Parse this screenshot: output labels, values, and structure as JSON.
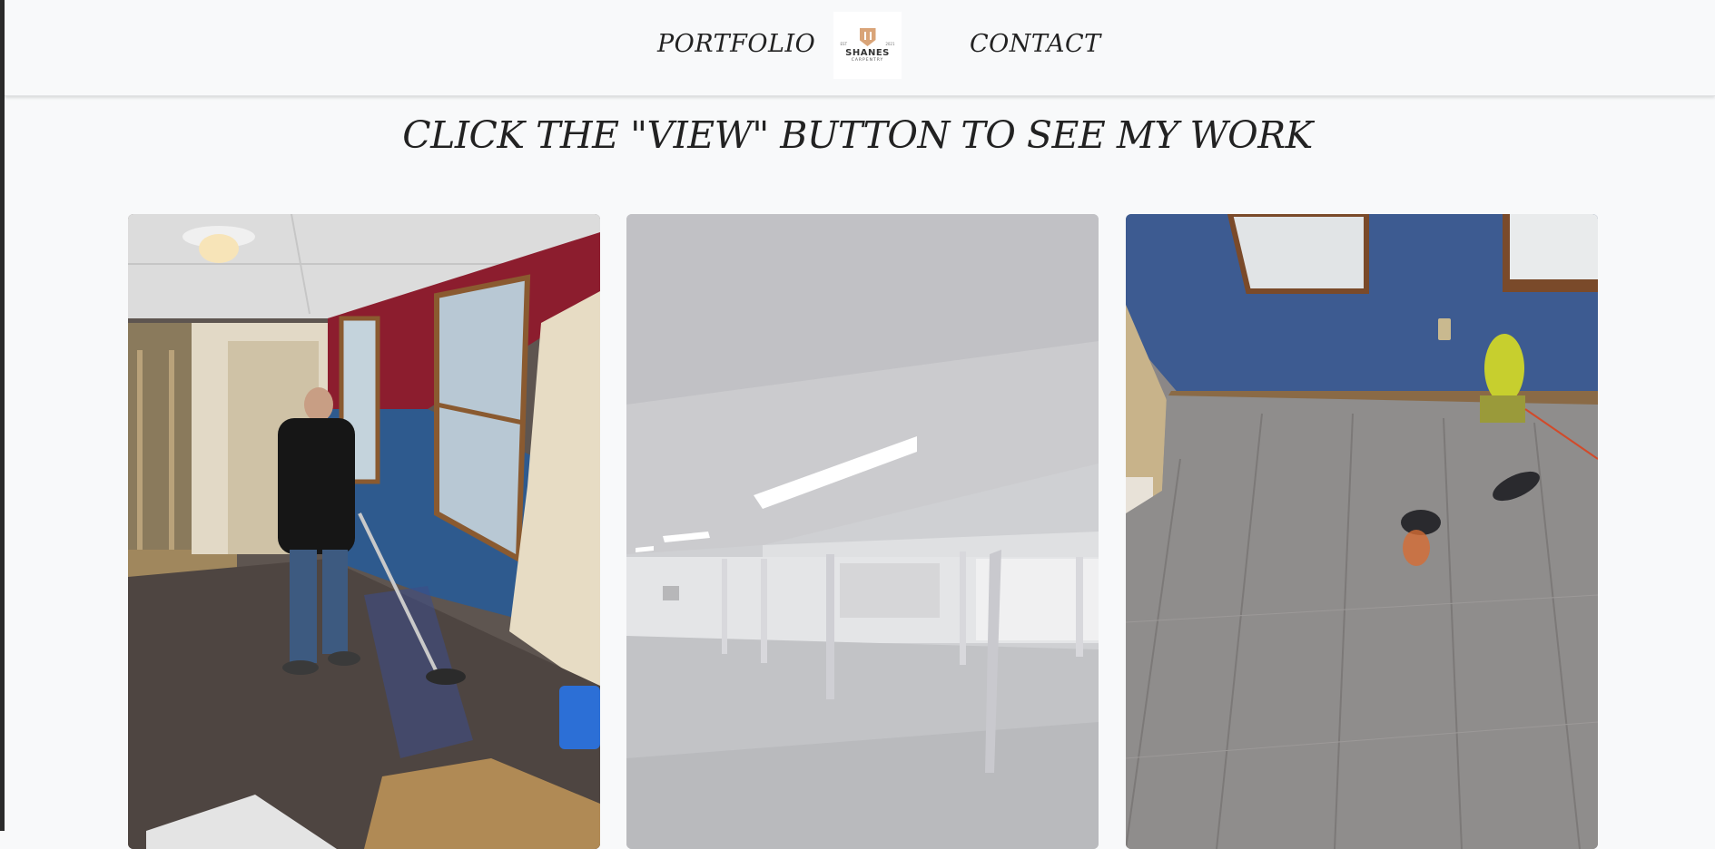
{
  "nav": {
    "portfolio_label": "PORTFOLIO",
    "contact_label": "CONTACT",
    "logo": {
      "name": "SHANES",
      "subtitle": "CARPENTRY",
      "est_left": "EST",
      "est_right": "2021"
    }
  },
  "main": {
    "heading": "CLICK THE \"VIEW\" BUTTON TO SEE MY WORK"
  },
  "portfolio": {
    "items": [
      {
        "icon": "photo-floor-epoxy-coating"
      },
      {
        "icon": "photo-finished-basement"
      },
      {
        "icon": "photo-vinyl-plank-floor"
      }
    ]
  },
  "colors": {
    "background": "#f8f9fa",
    "text": "#222222",
    "logo_accent": "#d9a478"
  }
}
